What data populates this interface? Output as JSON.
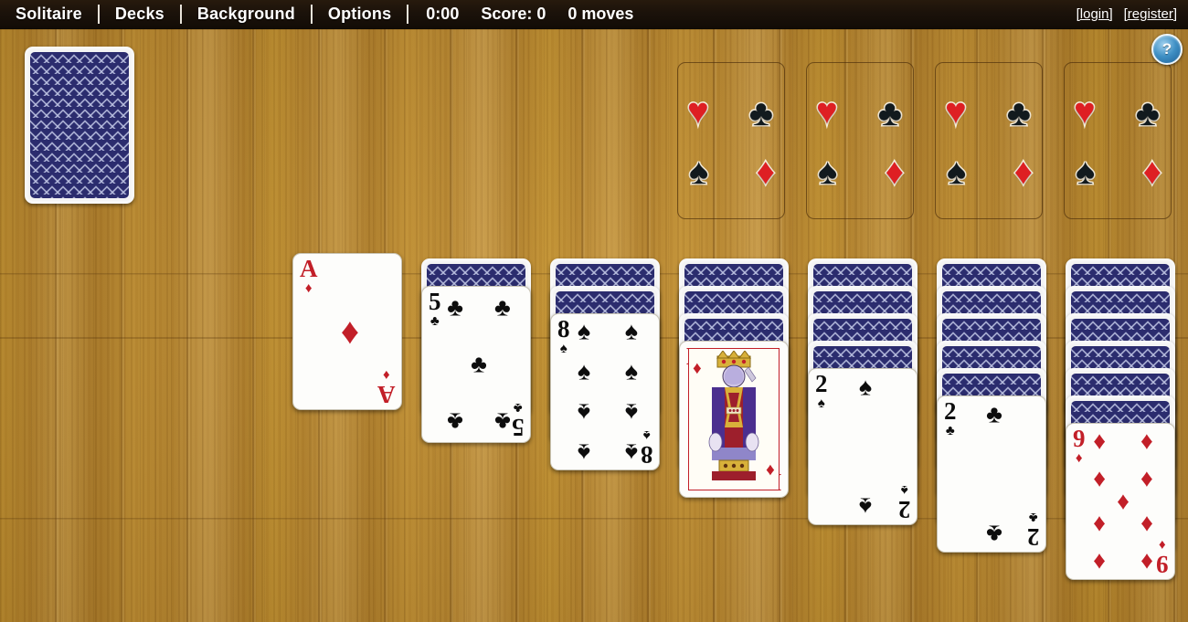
{
  "menu": {
    "items": [
      {
        "label": "Solitaire",
        "name": "menu-solitaire"
      },
      {
        "label": "Decks",
        "name": "menu-decks"
      },
      {
        "label": "Background",
        "name": "menu-background"
      },
      {
        "label": "Options",
        "name": "menu-options"
      }
    ],
    "timer": "0:00",
    "score": "Score: 0",
    "moves": "0 moves",
    "login": "[login]",
    "register": "[register]",
    "separator": "|"
  },
  "help": {
    "glyph": "?",
    "name": "help-icon"
  },
  "colors": {
    "menu_bar": "#1b120a",
    "table_wood": "#bb8a33",
    "card_back": "#2b2c6e",
    "card_face": "#fdfdfb",
    "red_suit": "#c21f28",
    "black_suit": "#0d0d0d",
    "help_blue": "#3e8fc4"
  },
  "suits": {
    "heart": "♥",
    "diamond": "♦",
    "club": "♣",
    "spade": "♠"
  },
  "stock": {
    "label": "stock-pile",
    "face_down": true
  },
  "waste": {
    "label": "waste-pile",
    "empty": true
  },
  "foundations": [
    {
      "index": 1,
      "empty": true
    },
    {
      "index": 2,
      "empty": true
    },
    {
      "index": 3,
      "empty": true
    },
    {
      "index": 4,
      "empty": true
    }
  ],
  "tableau": [
    {
      "column": 1,
      "face_down": 0,
      "face_up": [
        {
          "rank": "A",
          "suit": "diamond",
          "color": "red"
        }
      ]
    },
    {
      "column": 2,
      "face_down": 1,
      "face_up": [
        {
          "rank": "5",
          "suit": "club",
          "color": "black"
        }
      ]
    },
    {
      "column": 3,
      "face_down": 2,
      "face_up": [
        {
          "rank": "8",
          "suit": "spade",
          "color": "black"
        }
      ]
    },
    {
      "column": 4,
      "face_down": 3,
      "face_up": [
        {
          "rank": "K",
          "suit": "diamond",
          "color": "red"
        }
      ]
    },
    {
      "column": 5,
      "face_down": 4,
      "face_up": [
        {
          "rank": "2",
          "suit": "spade",
          "color": "black"
        }
      ]
    },
    {
      "column": 6,
      "face_down": 5,
      "face_up": [
        {
          "rank": "2",
          "suit": "club",
          "color": "black"
        }
      ]
    },
    {
      "column": 7,
      "face_down": 6,
      "face_up": [
        {
          "rank": "9",
          "suit": "diamond",
          "color": "red"
        }
      ]
    }
  ]
}
